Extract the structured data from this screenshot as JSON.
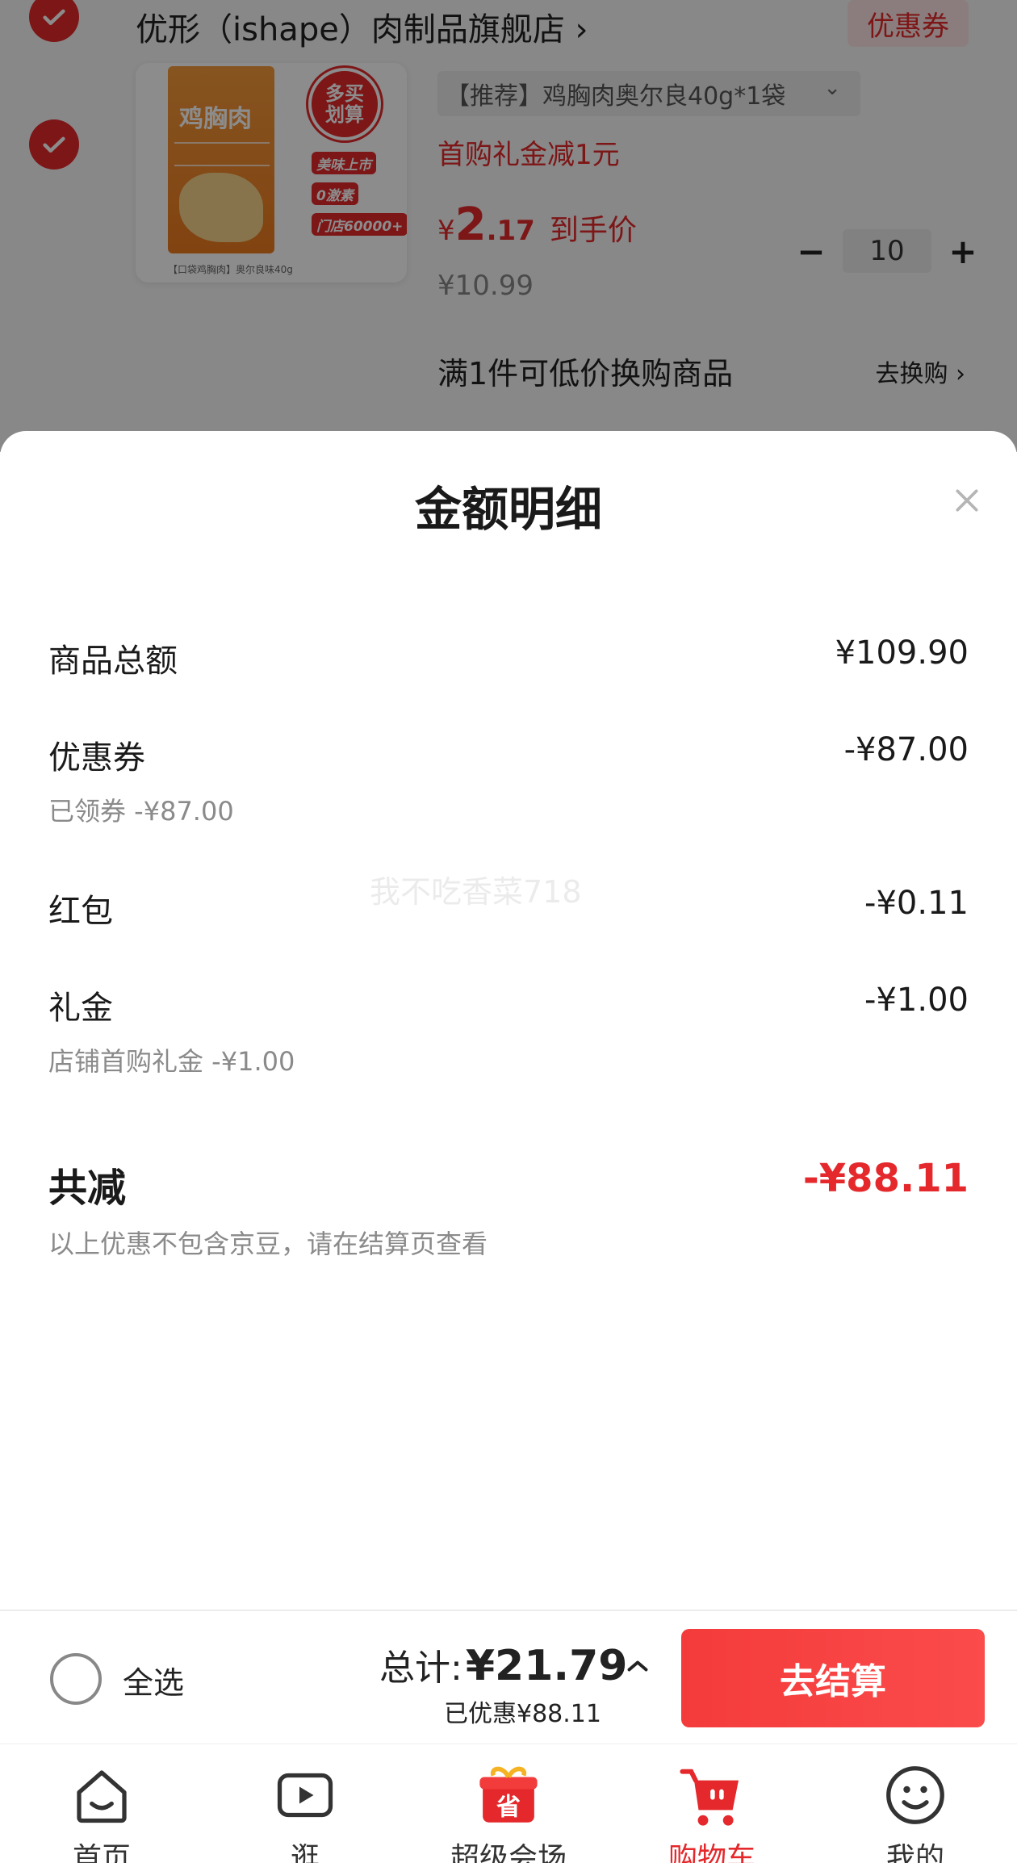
{
  "cart_item": {
    "shop_name": "优形（ishape）肉制品旗舰店 ›",
    "coupon_label": "优惠券",
    "product_image": {
      "pkg_title": "鸡胸肉",
      "badge_text": [
        "多买",
        "划算"
      ],
      "badge_tags": [
        "美味上市",
        "0激素",
        "门店60000+"
      ],
      "caption": "【口袋鸡胸肉】奥尔良味40g"
    },
    "spec": "【推荐】鸡胸肉奥尔良40g*1袋",
    "promo": "首购礼金减1元",
    "price_yen": "¥",
    "price_int": "2",
    "price_dec": ".17",
    "price_tag": "到手价",
    "original_price": "¥10.99",
    "quantity": "10",
    "qty_minus": "−",
    "qty_plus": "+",
    "exchange_text": "满1件可低价换购商品",
    "exchange_link": "去换购 ›"
  },
  "sheet": {
    "title": "金额明细",
    "rows": [
      {
        "label": "商品总额",
        "value": "¥109.90"
      },
      {
        "label": "优惠券",
        "value": "-¥87.00",
        "sub": "已领券 -¥87.00"
      },
      {
        "label": "红包",
        "value": "-¥0.11"
      },
      {
        "label": "礼金",
        "value": "-¥1.00",
        "sub": "店铺首购礼金 -¥1.00"
      }
    ],
    "total": {
      "label": "共减",
      "value": "-¥88.11"
    },
    "note": "以上优惠不包含京豆，请在结算页查看",
    "watermark": "我不吃香菜718"
  },
  "bottom_bar": {
    "select_all": "全选",
    "total_label": "总计:",
    "total_amount": "¥21.79",
    "saved": "已优惠¥88.11",
    "checkout": "去结算"
  },
  "tabs": [
    {
      "label": "首页",
      "icon": "home-icon"
    },
    {
      "label": "逛",
      "icon": "video-play-icon"
    },
    {
      "label": "超级会场",
      "icon": "super-venue-gift-icon",
      "icon_text": "省"
    },
    {
      "label": "购物车",
      "icon": "shopping-cart-icon",
      "active": true
    },
    {
      "label": "我的",
      "icon": "profile-smile-icon"
    }
  ],
  "colors": {
    "accent": "#e4282b",
    "checkout_gradient_start": "#f43b3b",
    "overlay": "rgba(0,0,0,0.45)"
  }
}
